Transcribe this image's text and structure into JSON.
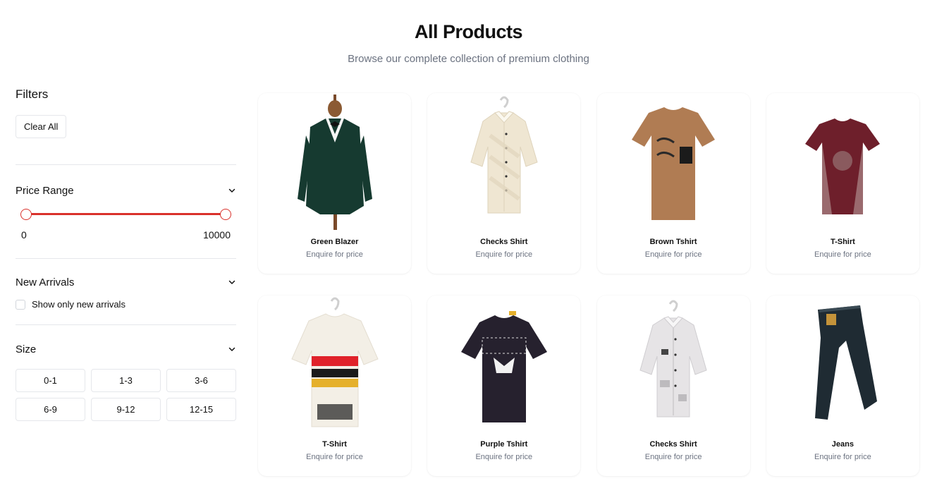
{
  "header": {
    "title": "All Products",
    "subtitle": "Browse our complete collection of premium clothing"
  },
  "filters": {
    "title": "Filters",
    "clear_label": "Clear All",
    "price": {
      "title": "Price Range",
      "min_label": "0",
      "max_label": "10000",
      "selected_min": 0,
      "selected_max": 10000,
      "accent_color": "#d9312b"
    },
    "new_arrivals": {
      "title": "New Arrivals",
      "checkbox_label": "Show only new arrivals",
      "checked": false
    },
    "size": {
      "title": "Size",
      "options": [
        "0-1",
        "1-3",
        "3-6",
        "6-9",
        "9-12",
        "12-15"
      ]
    }
  },
  "products": [
    {
      "name": "Green Blazer",
      "price": "Enquire for price",
      "icon": "blazer-icon",
      "color": "#163a30"
    },
    {
      "name": "Checks Shirt",
      "price": "Enquire for price",
      "icon": "shirt-icon",
      "color": "#efe6d2"
    },
    {
      "name": "Brown Tshirt",
      "price": "Enquire for price",
      "icon": "tshirt-icon",
      "color": "#b07c53"
    },
    {
      "name": "T-Shirt",
      "price": "Enquire for price",
      "icon": "tshirt-icon",
      "color": "#6e1f2b"
    },
    {
      "name": "T-Shirt",
      "price": "Enquire for price",
      "icon": "tshirt-icon",
      "color": "#f3efe6"
    },
    {
      "name": "Purple Tshirt",
      "price": "Enquire for price",
      "icon": "tshirt-icon",
      "color": "#26212e"
    },
    {
      "name": "Checks Shirt",
      "price": "Enquire for price",
      "icon": "shirt-icon",
      "color": "#e6e4e6"
    },
    {
      "name": "Jeans",
      "price": "Enquire for price",
      "icon": "jeans-icon",
      "color": "#1f2b33"
    }
  ]
}
